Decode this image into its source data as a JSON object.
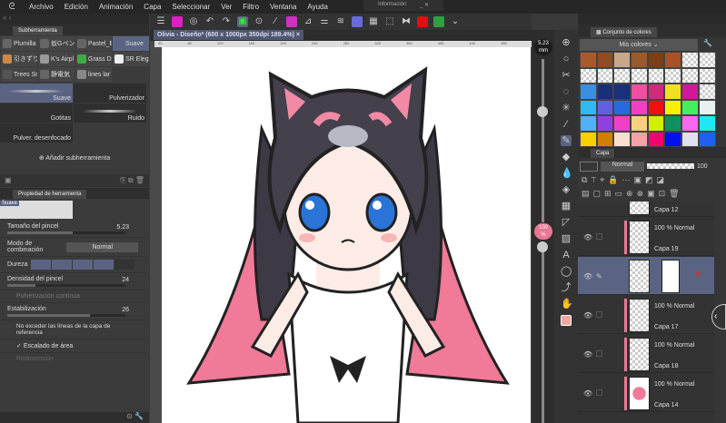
{
  "menu": {
    "items": [
      "Archivo",
      "Edición",
      "Animación",
      "Capa",
      "Seleccionar",
      "Ver",
      "Filtro",
      "Ventana",
      "Ayuda"
    ]
  },
  "info_window": {
    "title": "Información"
  },
  "subtool_panel": {
    "tab": "Subherramienta",
    "brushes": [
      "Plumilla",
      "仮Gペン",
      "Pastel_E",
      "Suave",
      "引きずり",
      "K's Airpl",
      "Grass D",
      "SR Eleg",
      "Trees Sr",
      "静電気",
      "lines lar"
    ],
    "selected": "Suave",
    "previews": [
      "Suave",
      "Pulverizador",
      "Gotitas",
      "Ruido",
      "Pulver. desenfocado"
    ],
    "add_label": "Añadir subherramienta"
  },
  "tool_property": {
    "tab": "Propiedad de herramienta",
    "preview_label": "Suave",
    "brush_size_label": "Tamaño del pincel",
    "brush_size": "5.23",
    "brush_size_fraction": 0.55,
    "blend_label": "Modo de combinación",
    "blend_value": "Normal",
    "hardness_label": "Dureza",
    "hardness_level": 4,
    "hardness_max": 5,
    "density_label": "Densidad del pincel",
    "density": "24",
    "density_fraction": 0.24,
    "continuous_label": "Pulverización continua",
    "stabilization_label": "Estabilización",
    "stabilization": "26",
    "stabilization_fraction": 0.7,
    "ref_label": "No exceder las líneas de la capa de referencia",
    "area_scaling_label": "Escalado de área",
    "resize_label": "Redimensión"
  },
  "document": {
    "tab": "Olivia - Diseño* (600 x 1000px 350dpi 189.4%)",
    "close": "×",
    "ruler": [
      "40",
      "80",
      "120",
      "160",
      "200",
      "240",
      "280",
      "320",
      "360",
      "400",
      "440",
      "480",
      "520",
      "560"
    ]
  },
  "brush_size_indicator": {
    "value": "5.23",
    "unit": "mm"
  },
  "zoom_indicator": {
    "value": "100",
    "unit": "%"
  },
  "color_set": {
    "tab": "Conjunto de colores",
    "set_name": "Mis colores",
    "swatches": [
      "#a95a2c",
      "#8f4e22",
      "#c8a88a",
      "#9a5a2a",
      "#7a3f14",
      "#a65226",
      null,
      null,
      null,
      null,
      null,
      null,
      null,
      null,
      null,
      null,
      "#3a8fe0",
      "#1a2f7a",
      "#1a3078",
      "#f04fa0",
      "#d02a7a",
      "#f0e020",
      "#d0189a",
      null,
      "#30b8f0",
      "#6060e0",
      "#2a68e0",
      "#f040c8",
      "#f01010",
      "#f8f000",
      "#40f060",
      "#e8f0f0",
      "#50b0f8",
      "#9040e0",
      "#f040c8",
      "#f8d080",
      "#d0f000",
      "#109060",
      "#f868f0",
      "#20e8f0",
      "#f8d000",
      "#d08000",
      "#f8e0d0",
      "#f8a0a8",
      "#f00070",
      "#0010f0",
      "#e0e0f0",
      "#2060f0"
    ]
  },
  "layers": {
    "tab": "Capa",
    "blend": "Normal",
    "opacity": "100",
    "rows": [
      {
        "name": "Capa 12",
        "mode": ""
      },
      {
        "name": "Capa 19",
        "mode": "100 % Normal"
      },
      {
        "name": "",
        "mode": ""
      },
      {
        "name": "Capa 17",
        "mode": "100 % Normal"
      },
      {
        "name": "Capa 18",
        "mode": "100 % Normal"
      },
      {
        "name": "Capa 14",
        "mode": "100 % Normal"
      }
    ]
  },
  "colors": {
    "accent": "#5a6482",
    "layer_color": "#e97893",
    "main_color": "#f2a6a0"
  }
}
